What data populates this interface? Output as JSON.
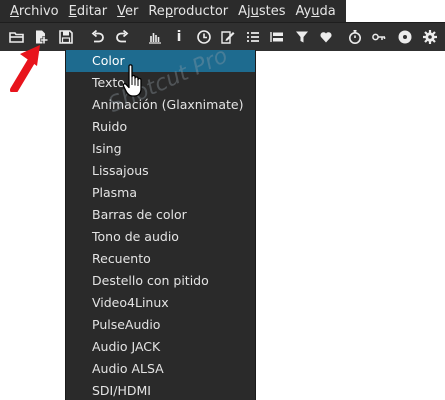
{
  "menubar": {
    "items": [
      {
        "pre": "",
        "acc": "A",
        "post": "rchivo"
      },
      {
        "pre": "",
        "acc": "E",
        "post": "ditar"
      },
      {
        "pre": "",
        "acc": "V",
        "post": "er"
      },
      {
        "pre": "Re",
        "acc": "p",
        "post": "roductor"
      },
      {
        "pre": "Aj",
        "acc": "u",
        "post": "stes"
      },
      {
        "pre": "Ay",
        "acc": "u",
        "post": "da"
      }
    ]
  },
  "toolbar": {
    "info_label": "i"
  },
  "dropdown": {
    "selected_index": 0,
    "items": [
      "Color",
      "Texto",
      "Animación (Glaxnimate)",
      "Ruido",
      "Ising",
      "Lissajous",
      "Plasma",
      "Barras de color",
      "Tono de audio",
      "Recuento",
      "Destello con pitido",
      "Video4Linux",
      "PulseAudio",
      "Audio JACK",
      "Audio ALSA",
      "SDI/HDMI"
    ]
  },
  "watermark": "Shotcut Pro",
  "colors": {
    "menubar_bg": "#2b2b2b",
    "toolbar_bg": "#303030",
    "dropdown_bg": "#2a2a2a",
    "selected_bg": "#1e6b8f",
    "annotation_arrow": "#e8141c"
  }
}
